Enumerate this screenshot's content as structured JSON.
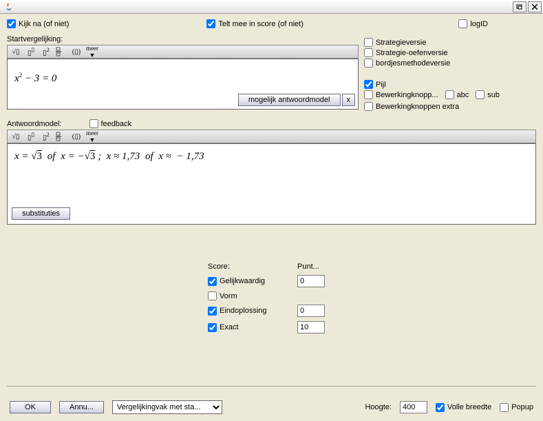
{
  "checkboxes": {
    "kijkna": "Kijk na (of niet)",
    "teltmee": "Telt mee in score (of niet)",
    "logid": "logID",
    "strategieversie": "Strategieversie",
    "strategieoefen": "Strategie-oefenversie",
    "bordjes": "bordjesmethodeversie",
    "pijl": "Pijl",
    "bewerkingknop": "Bewerkingknopp...",
    "abc": "abc",
    "sub": "sub",
    "bewerkingextra": "Bewerkingknoppen extra",
    "feedback": "feedback",
    "gelijkwaardig": "Gelijkwaardig",
    "vorm": "Vorm",
    "eindoplossing": "Eindoplossing",
    "exact": "Exact",
    "vollebreedte": "Volle breedte",
    "popup": "Popup"
  },
  "labels": {
    "startvergelijking": "Startvergelijking:",
    "antwoordmodel": "Antwoordmodel:",
    "score": "Score:",
    "punt": "Punt...",
    "hoogte": "Hoogte:",
    "meer": "meer"
  },
  "buttons": {
    "mogelijk": "mogelijk antwoordmodel",
    "x": "x",
    "substituties": "substituties",
    "ok": "OK",
    "annu": "Annu..."
  },
  "select": {
    "vergelijkingvak": "Vergelijkingvak met sta..."
  },
  "values": {
    "gelijkwaardig_pt": "0",
    "eindoplossing_pt": "0",
    "exact_pt": "10",
    "hoogte": "400"
  },
  "formulas": {
    "start": "x² − 3 = 0",
    "answer": "x = √3  of  x = −√3 ;  x ≈ 1,73  of  x ≈  − 1,73"
  }
}
